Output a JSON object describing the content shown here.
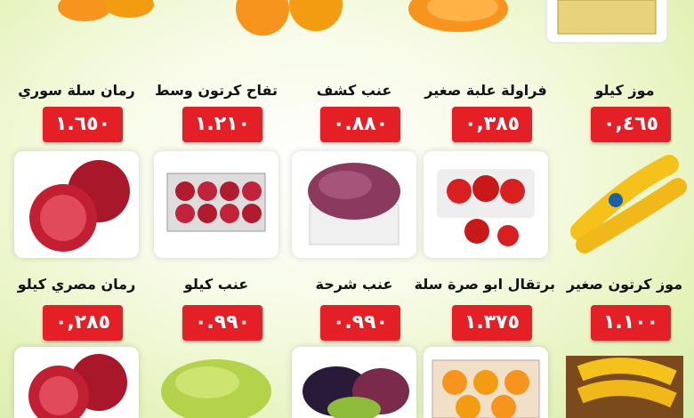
{
  "row1": [
    {
      "name": "موز كيلو",
      "price": "٠,٤٦٥"
    },
    {
      "name": "فراولة علبة صغير",
      "price": "٠,٣٨٥"
    },
    {
      "name": "عنب كشف",
      "price": "٠.٨٨٠"
    },
    {
      "name": "تفاح كرتون وسط",
      "price": "١.٢١٠"
    },
    {
      "name": "رمان سلة سوري",
      "price": "١.٦٥٠"
    }
  ],
  "row2": [
    {
      "name": "موز كرتون صغير",
      "price": "١.١٠٠"
    },
    {
      "name": "برتقال ابو صرة سلة",
      "price": "١.٣٧٥"
    },
    {
      "name": "عنب شرحة",
      "price": "٠.٩٩٠"
    },
    {
      "name": "عنب كيلو",
      "price": "٠.٩٩٠"
    },
    {
      "name": "رمان مصري كيلو",
      "price": "٠,٢٨٥"
    }
  ],
  "colors": {
    "price_bg": "#e41f26",
    "price_text": "#ffffff",
    "background": "#e4f2b8"
  }
}
